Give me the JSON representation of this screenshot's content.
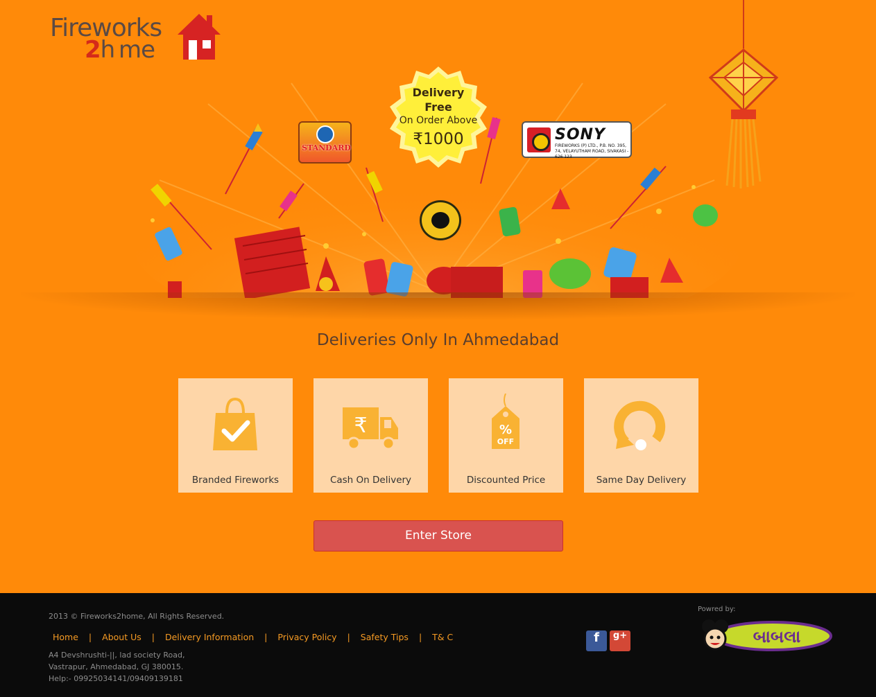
{
  "logo": {
    "line1": "Fireworks",
    "line2_num": "2",
    "line2_text": "h me"
  },
  "banner": {
    "badge": {
      "line1": "Delivery",
      "line2": "Free",
      "line3": "On Order Above",
      "amount": "₹1000"
    },
    "brands": {
      "standard": "STANDARD",
      "sony": "SONY",
      "sony_sub": "FIREWORKS (P) LTD., P.B. NO. 395, 74, VELAYUTHAM ROAD, SIVAKASI - 626 123"
    }
  },
  "headline": "Deliveries Only In Ahmedabad",
  "features": [
    {
      "label": "Branded Fireworks",
      "icon": "shopping-bag-check-icon"
    },
    {
      "label": "Cash On Delivery",
      "icon": "rupee-truck-icon"
    },
    {
      "label": "Discounted Price",
      "icon": "percent-off-tag-icon"
    },
    {
      "label": "Same Day Delivery",
      "icon": "refresh-circle-icon"
    }
  ],
  "enter_store": "Enter Store",
  "footer": {
    "copyright": "2013 © Fireworks2home, All Rights Reserved.",
    "links": [
      "Home",
      "About Us",
      "Delivery Information",
      "Privacy Policy",
      "Safety Tips",
      "T& C"
    ],
    "separator": "|",
    "address": [
      "A4 Devshrushti-||, lad society Road,",
      "Vastrapur, Ahmedabad, GJ 380015.",
      "Help:- 09925034141/09409139181"
    ],
    "social": {
      "facebook": "f",
      "google_plus": "g+"
    },
    "powered_by": "Powred by:",
    "powered_logo_text": "બાબલા"
  },
  "colors": {
    "background": "#ff8a09",
    "card": "#fed6a8",
    "icon": "#f9b233",
    "button": "#d9534f",
    "footer": "#0b0b0b",
    "link": "#f59a23"
  }
}
